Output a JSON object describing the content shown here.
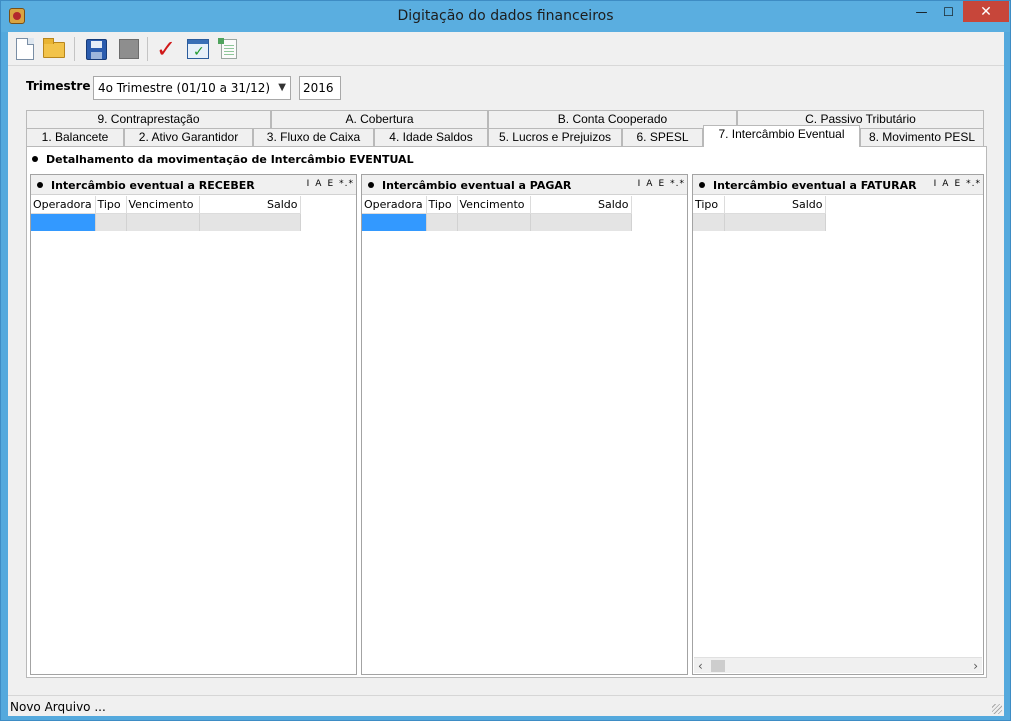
{
  "window": {
    "title": "Digitação do dados financeiros",
    "controls": {
      "minimize": "—",
      "maximize": "☐",
      "close": "✕"
    }
  },
  "toolbar": {
    "buttons": [
      {
        "name": "new-file-icon"
      },
      {
        "name": "open-folder-icon"
      },
      {
        "name": "save-icon"
      },
      {
        "name": "disabled-icon"
      },
      {
        "name": "checkmark-icon",
        "glyph": "✓"
      },
      {
        "name": "calc-check-icon",
        "glyph": "✓"
      },
      {
        "name": "spreadsheet-icon"
      }
    ]
  },
  "filter": {
    "label": "Trimestre",
    "selected": "4o Trimestre (01/10 a 31/12)",
    "year": "2016"
  },
  "tabs": {
    "row1": [
      "9. Contraprestação",
      "A. Cobertura",
      "B. Conta Cooperado",
      "C. Passivo Tributário"
    ],
    "row2": [
      "1. Balancete",
      "2. Ativo Garantidor",
      "3. Fluxo de Caixa",
      "4. Idade Saldos",
      "5. Lucros e Prejuizos",
      "6. SPESL",
      "7. Intercâmbio Eventual",
      "8. Movimento PESL"
    ],
    "active": "7. Intercâmbio Eventual"
  },
  "panel": {
    "title": "Detalhamento da movimentação de Intercâmbio EVENTUAL",
    "tools": [
      "I",
      "A",
      "E",
      "*.*"
    ],
    "sections": [
      {
        "title": "Intercâmbio eventual a RECEBER",
        "columns": [
          "Operadora",
          "Tipo",
          "Vencimento",
          "Saldo"
        ]
      },
      {
        "title": "Intercâmbio eventual a PAGAR",
        "columns": [
          "Operadora",
          "Tipo",
          "Vencimento",
          "Saldo"
        ]
      },
      {
        "title": "Intercâmbio eventual a FATURAR",
        "columns": [
          "Tipo",
          "Saldo"
        ]
      }
    ]
  },
  "status": {
    "text": "Novo Arquivo ..."
  },
  "colors": {
    "titlebar": "#5aaee0",
    "close": "#c7463a",
    "selection": "#3399ff"
  }
}
